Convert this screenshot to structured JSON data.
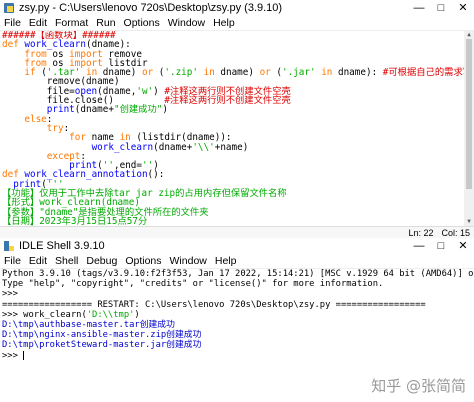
{
  "editor_window": {
    "title": "zsy.py - C:\\Users\\lenovo 720s\\Desktop\\zsy.py (3.9.10)",
    "menu": [
      "File",
      "Edit",
      "Format",
      "Run",
      "Options",
      "Window",
      "Help"
    ],
    "status": {
      "line": "Ln: 22",
      "col": "Col: 15"
    },
    "code": [
      "######【函数块】######",
      "def work_clearn(dname):",
      "    from os import remove",
      "    from os import listdir",
      "    if ('.tar' in dname) or ('.zip' in dname) or ('.jar' in dname): #可根据自己的需求写入要清理的文件类型",
      "        remove(dname)",
      "        file=open(dname,'w') #注释这两行则不创建文件空壳",
      "        file.close()         #注释这两行则不创建文件空壳",
      "        print(dname+\"创建成功\")",
      "    else:",
      "        try:",
      "            for name in (listdir(dname)):",
      "                work_clearn(dname+'\\\\'+name)",
      "        except:",
      "            print('',end='')",
      "def work_clearn_annotation():",
      "  print('''",
      "【功能】仅用于工作中去除tar jar zip的占用内存但保留文件名称",
      "【形式】work_clearn(dname)",
      "【参数】\"dname\"是指要处理的文件所在的文件夹",
      "【日期】2023年3月15日15点57分",
      "  ''')"
    ]
  },
  "shell_window": {
    "title": "IDLE Shell 3.9.10",
    "menu": [
      "File",
      "Edit",
      "Shell",
      "Debug",
      "Options",
      "Window",
      "Help"
    ],
    "lines": [
      "Python 3.9.10 (tags/v3.9.10:f2f3f53, Jan 17 2022, 15:14:21) [MSC v.1929 64 bit (AMD64)] on win32",
      "Type \"help\", \"copyright\", \"credits\" or \"license()\" for more information.",
      ">>>",
      "================= RESTART: C:\\Users\\lenovo 720s\\Desktop\\zsy.py =================",
      ">>> work_clearn('D:\\\\tmp')",
      "D:\\tmp\\authbase-master.tar创建成功",
      "D:\\tmp\\nginx-ansible-master.zip创建成功",
      "D:\\tmp\\proketSteward-master.jar创建成功",
      ">>> "
    ]
  },
  "watermark": "知乎 @张简简",
  "colors": {
    "keyword": "#ff7700",
    "builtin": "#0000ff",
    "string": "#00aa00",
    "comment": "#dd0000",
    "output": "#0000cc"
  }
}
